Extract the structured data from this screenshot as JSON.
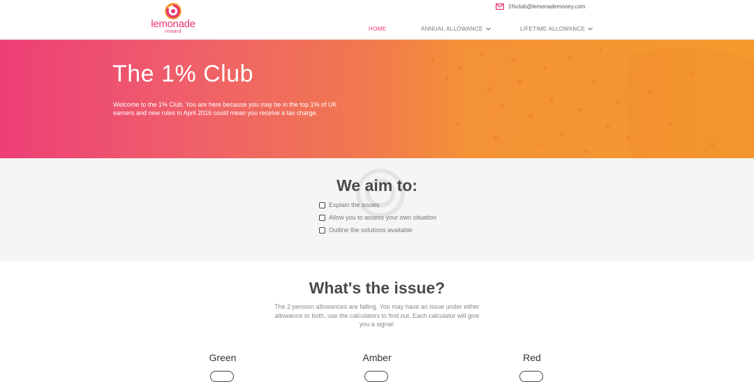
{
  "brand": {
    "name": "lemonade",
    "sub": "reward"
  },
  "contact": {
    "email": "1%club@lemonademoney.com",
    "icon": "mail-icon"
  },
  "nav": {
    "items": [
      {
        "label": "HOME",
        "active": true
      },
      {
        "label": "ANNUAL ALLOWANCE",
        "dropdown": true
      },
      {
        "label": "LIFETIME ALLOWANCE",
        "dropdown": true
      }
    ]
  },
  "hero": {
    "title": "The 1% Club",
    "text": "Welcome to the 1% Club. You are here because you may be in the top 1% of UK earners and new rules in April 2016 could mean you receive a tax charge."
  },
  "aims": {
    "title": "We aim to:",
    "items": [
      "Explain the issues",
      "Allow you to assess your own situation",
      "Outline the solutions available"
    ]
  },
  "issue": {
    "title": "What's the issue?",
    "text": "The 2 pension allowances are falling. You may have an issue under either allowance or both, use the calculators to find out. Each calculator will give you a signal:",
    "signals": [
      "Green",
      "Amber",
      "Red"
    ]
  },
  "colors": {
    "accent": "#e8356d",
    "hero_start": "#ee3f77",
    "hero_end": "#f59a2e"
  }
}
